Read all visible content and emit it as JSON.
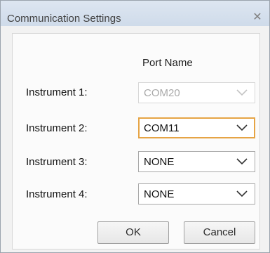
{
  "dialog": {
    "title": "Communication Settings",
    "close_icon": "close-icon"
  },
  "header": {
    "port_name": "Port Name"
  },
  "instruments": [
    {
      "label": "Instrument 1:",
      "value": "COM20",
      "enabled": false,
      "focused": false
    },
    {
      "label": "Instrument 2:",
      "value": "COM11",
      "enabled": true,
      "focused": true
    },
    {
      "label": "Instrument 3:",
      "value": "NONE",
      "enabled": true,
      "focused": false
    },
    {
      "label": "Instrument 4:",
      "value": "NONE",
      "enabled": true,
      "focused": false
    }
  ],
  "buttons": {
    "ok": "OK",
    "cancel": "Cancel"
  },
  "colors": {
    "focus_border": "#e6a445",
    "disabled_text": "#a9a9a9",
    "titlebar": "#d6e1ee"
  }
}
